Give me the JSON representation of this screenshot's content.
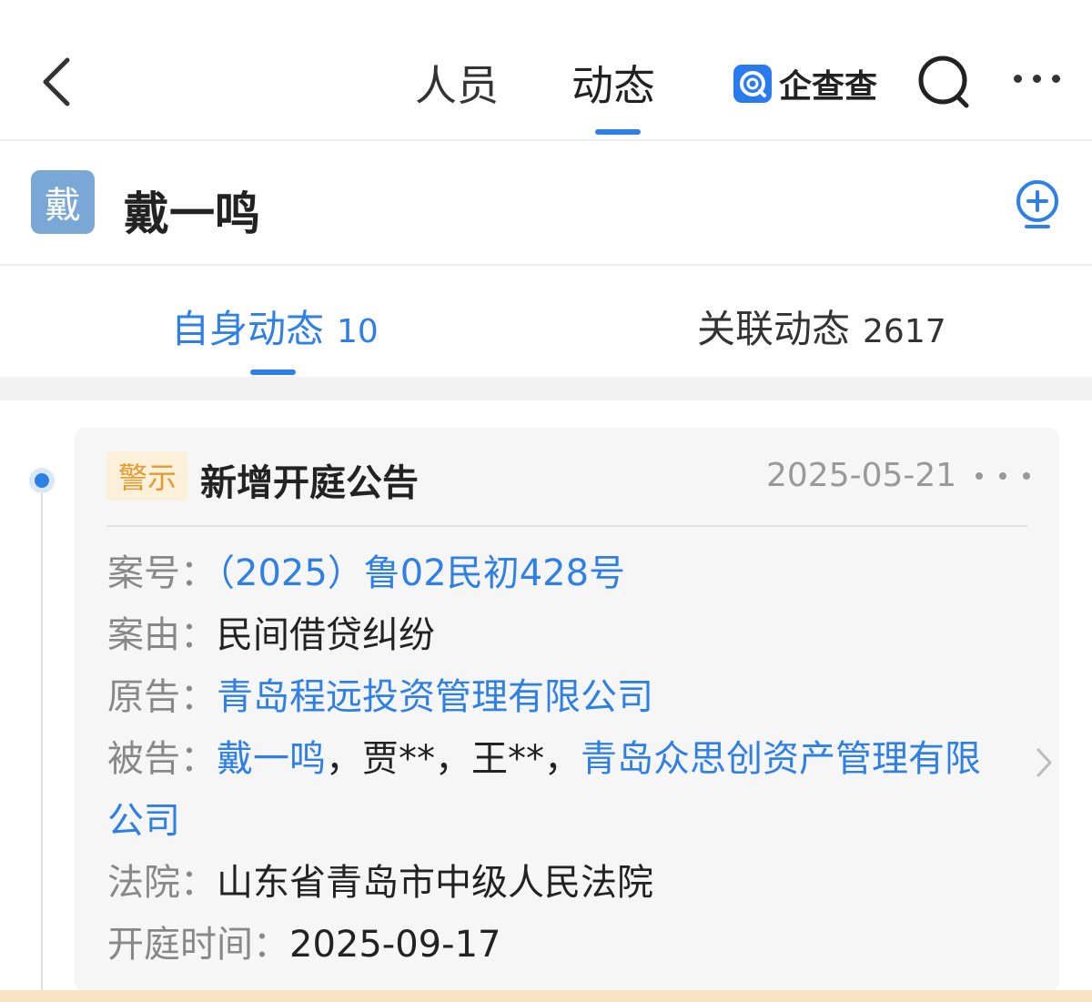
{
  "topnav": {
    "tabs": [
      {
        "label": "人员"
      },
      {
        "label": "动态"
      }
    ],
    "brand": "企查查"
  },
  "person": {
    "avatar_char": "戴",
    "name": "戴一鸣"
  },
  "subtabs": [
    {
      "label": "自身动态",
      "count": "10"
    },
    {
      "label": "关联动态",
      "count": "2617"
    }
  ],
  "card": {
    "badge": "警示",
    "title": "新增开庭公告",
    "date": "2025-05-21",
    "fields": {
      "case_no_label": "案号：",
      "case_no": "（2025）鲁02民初428号",
      "cause_label": "案由：",
      "cause": "民间借贷纠纷",
      "plaintiff_label": "原告：",
      "plaintiff": "青岛程远投资管理有限公司",
      "defendant_label": "被告：",
      "defendants": [
        "戴一鸣",
        "贾**",
        "王**",
        "青岛众思创资产管理有限",
        "公司"
      ],
      "separator": "，",
      "court_label": "法院：",
      "court": "山东省青岛市中级人民法院",
      "hearing_label": "开庭时间：",
      "hearing": "2025-09-17"
    }
  },
  "colors": {
    "accent": "#2f80e6",
    "badge_bg": "#fbf0da",
    "badge_text": "#e59a2f",
    "card_bg": "#f6f6f6"
  }
}
